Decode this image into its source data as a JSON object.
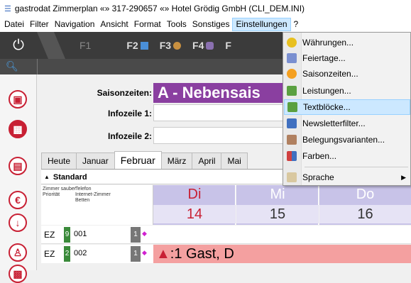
{
  "window": {
    "title": "gastrodat Zimmerplan «» 317-290657 «» Hotel Grödig GmbH (CLI_DEM.INI)"
  },
  "menubar": {
    "items": [
      "Datei",
      "Filter",
      "Navigation",
      "Ansicht",
      "Format",
      "Tools",
      "Sonstiges",
      "Einstellungen",
      "?"
    ]
  },
  "toolbar": {
    "f1": "F1",
    "f2": "F2",
    "f3": "F3",
    "f4": "F4",
    "f5": "F"
  },
  "fields": {
    "saison_label": "Saisonzeiten:",
    "saison_value": "A - Nebensais",
    "info1_label": "Infozeile 1:",
    "info2_label": "Infozeile 2:"
  },
  "tabs": [
    "Heute",
    "Januar",
    "Februar",
    "März",
    "April",
    "Mai"
  ],
  "grid": {
    "group": "Standard",
    "col1a": "Zimmer sauber",
    "col1b": "Priorität",
    "col2a": "Telefon",
    "col2b": "Internet-Zimmer",
    "col2c": "Betten",
    "days": [
      {
        "name": "Di",
        "num": "14"
      },
      {
        "name": "Mi",
        "num": "15"
      },
      {
        "name": "Do",
        "num": "16"
      }
    ],
    "rows": [
      {
        "type": "EZ",
        "prio": "9",
        "room": "001",
        "beds": "1"
      },
      {
        "type": "EZ",
        "prio": "2",
        "room": "002",
        "beds": "1",
        "guest": ":1 Gast, D"
      }
    ]
  },
  "menu": {
    "items": [
      {
        "label": "Währungen...",
        "accel": "W",
        "icon": "coins-icon",
        "color": "#e8c020"
      },
      {
        "label": "Feiertage...",
        "accel": "F",
        "icon": "holiday-icon",
        "color": "#7a8fd0"
      },
      {
        "label": "Saisonzeiten...",
        "accel": "S",
        "icon": "sun-icon",
        "color": "#f5a020"
      },
      {
        "label": "Leistungen...",
        "accel": "L",
        "icon": "services-icon",
        "color": "#5aa040"
      },
      {
        "label": "Textblöcke...",
        "accel": "T",
        "icon": "textblock-icon",
        "color": "#5aa040"
      },
      {
        "label": "Newsletterfilter...",
        "accel": "N",
        "icon": "newsletter-icon",
        "color": "#4070c0"
      },
      {
        "label": "Belegungsvarianten...",
        "accel": "B",
        "icon": "bed-icon",
        "color": "#b08060"
      },
      {
        "label": "Farben...",
        "accel": "F",
        "icon": "palette-icon",
        "color": "#d04040"
      },
      {
        "label": "Sprache",
        "accel": "S",
        "icon": "language-icon",
        "color": "#d9c8a0"
      }
    ]
  },
  "colors": {
    "accent_red": "#c82034",
    "purple": "#8a3fa0",
    "day_header": "#c8c3e8",
    "guest_bar": "#f4a0a0"
  }
}
